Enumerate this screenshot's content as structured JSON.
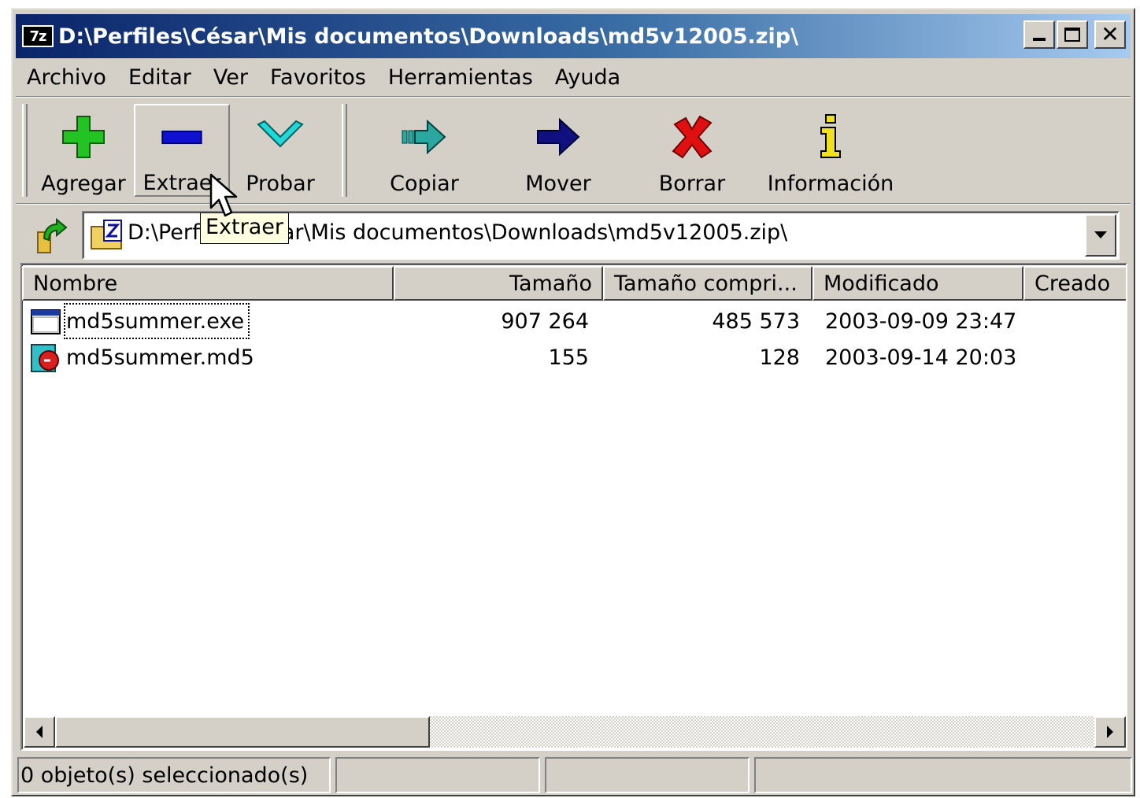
{
  "window": {
    "app_icon_text": "7z",
    "title": "D:\\Perfiles\\César\\Mis documentos\\Downloads\\md5v12005.zip\\"
  },
  "menu": [
    "Archivo",
    "Editar",
    "Ver",
    "Favoritos",
    "Herramientas",
    "Ayuda"
  ],
  "toolbar": {
    "add": "Agregar",
    "extract": "Extraer",
    "test": "Probar",
    "copy": "Copiar",
    "move": "Mover",
    "delete": "Borrar",
    "info": "Información"
  },
  "tooltip": "Extraer",
  "address": {
    "path": "D:\\Perfiles\\César\\Mis documentos\\Downloads\\md5v12005.zip\\"
  },
  "columns": [
    "Nombre",
    "Tamaño",
    "Tamaño compri...",
    "Modificado",
    "Creado"
  ],
  "files": [
    {
      "name": "md5summer.exe",
      "size": "907 264",
      "packed": "485 573",
      "modified": "2003-09-09 23:47",
      "created": ""
    },
    {
      "name": "md5summer.md5",
      "size": "155",
      "packed": "128",
      "modified": "2003-09-14 20:03",
      "created": ""
    }
  ],
  "status": {
    "selection": "0 objeto(s) seleccionado(s)",
    "pane2": "",
    "pane3": "",
    "pane4": ""
  },
  "icons": {
    "app": "7zip-icon",
    "add": "plus-icon",
    "extract": "minus-icon",
    "test": "check-icon",
    "copy": "copy-arrow-icon",
    "move": "move-arrow-icon",
    "delete": "x-icon",
    "info": "info-icon",
    "up": "up-folder-icon",
    "archive": "zip-folder-icon",
    "exe": "exe-file-icon",
    "md5": "md5-file-icon"
  },
  "colors": {
    "titlebar_start": "#0a246a",
    "titlebar_end": "#a6caf0",
    "face": "#d4d0c8",
    "tooltip": "#ffffe1"
  }
}
